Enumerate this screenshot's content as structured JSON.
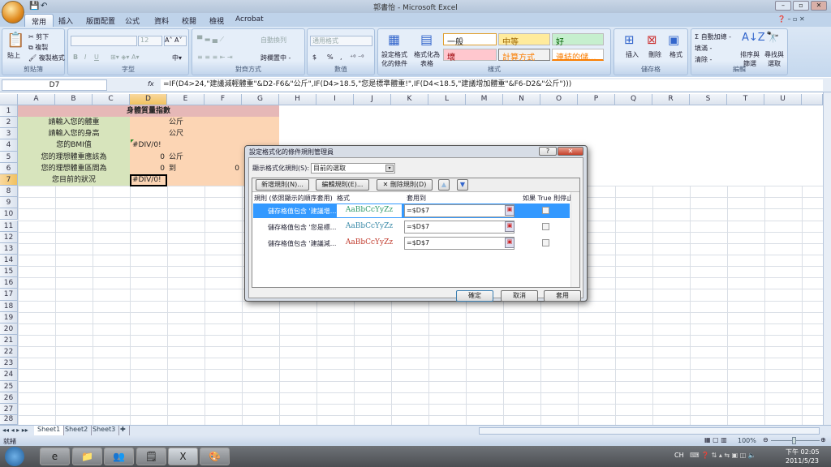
{
  "window": {
    "title": "新增活頁簿 - Microsoft Excel",
    "title_display": "郭書怡 - Microsoft Excel"
  },
  "tabs": [
    "常用",
    "插入",
    "版面配置",
    "公式",
    "資料",
    "校閱",
    "檢視",
    "Acrobat"
  ],
  "ribbon": {
    "clipboard": {
      "label": "剪貼簿",
      "paste": "貼上",
      "cut": "剪下",
      "copy": "複製",
      "format_painter": "複製格式"
    },
    "font": {
      "label": "字型",
      "size": "12",
      "bold": "B",
      "italic": "I",
      "underline": "U"
    },
    "alignment": {
      "label": "對齊方式",
      "wrap": "自動換列",
      "merge": "跨欄置中 -"
    },
    "number": {
      "label": "數值",
      "format": "通用格式",
      "currency": "$",
      "percent": "%",
      "comma": ","
    },
    "styles": {
      "label": "樣式",
      "conditional": "設定格式化的條件",
      "table": "格式化為表格",
      "cells": [
        "一般",
        "中等",
        "好",
        "壞",
        "計算方式",
        "連結的儲..."
      ]
    },
    "cells": {
      "label": "儲存格",
      "insert": "插入",
      "delete": "刪除",
      "format": "格式"
    },
    "editing": {
      "label": "編輯",
      "autosum": "Σ 自動加總 -",
      "fill": "填滿 -",
      "clear": "清除 -",
      "sort": "排序與篩選",
      "find": "尋找與選取"
    }
  },
  "formula_bar": {
    "name_box": "D7",
    "fx": "fx",
    "formula": "=IF(D4>24,\"建議減輕體重\"&D2-F6&\"公斤\",IF(D4>18.5,\"您是標準體重!\",IF(D4<18.5,\"建議增加體重\"&F6-D2&\"公斤\")))"
  },
  "columns": [
    "A",
    "B",
    "C",
    "D",
    "E",
    "F",
    "G",
    "H",
    "I",
    "J",
    "K",
    "L",
    "M",
    "N",
    "O",
    "P",
    "Q",
    "R",
    "S",
    "T",
    "U"
  ],
  "sheet": {
    "title": "身體質量指數",
    "labels": [
      "請輸入您的體重",
      "請輸入您的身高",
      "您的BMI值",
      "您的理想體重應該為",
      "您的理想體重區間為",
      "您目前的狀況"
    ],
    "d_values": [
      "",
      "",
      "#DIV/0!",
      "0",
      "0",
      "#DIV/0!"
    ],
    "e_values": [
      "公斤",
      "公尺",
      "",
      "公斤",
      "到",
      ""
    ],
    "f6": "0"
  },
  "sheet_tabs": [
    "Sheet1",
    "Sheet2",
    "Sheet3"
  ],
  "status": {
    "ready": "就緒",
    "zoom": "100%"
  },
  "dialog": {
    "title": "設定格式化的條件規則管理員",
    "show_label": "顯示格式化規則(S):",
    "show_value": "目前的選取",
    "new_rule": "新增規則(N)...",
    "edit_rule": "編輯規則(E)...",
    "delete_rule": "刪除規則(D)",
    "headers": [
      "規則 (依照顯示的順序套用)",
      "格式",
      "套用到",
      "如果 True 則停止"
    ],
    "rules": [
      {
        "name": "儲存格值包含 '建議增...",
        "preview": "AaBbCcYyZz",
        "color": "#2e9a6a",
        "applies": "=$D$7",
        "selected": true
      },
      {
        "name": "儲存格值包含 '您是標...",
        "preview": "AaBbCcYyZz",
        "color": "#3a8aa8",
        "applies": "=$D$7",
        "selected": false
      },
      {
        "name": "儲存格值包含 '建議減...",
        "preview": "AaBbCcYyZz",
        "color": "#c0392b",
        "applies": "=$D$7",
        "selected": false
      }
    ],
    "ok": "確定",
    "cancel": "取消",
    "apply": "套用"
  },
  "taskbar": {
    "lang": "CH",
    "time": "下午 02:05",
    "date": "2011/5/23"
  }
}
